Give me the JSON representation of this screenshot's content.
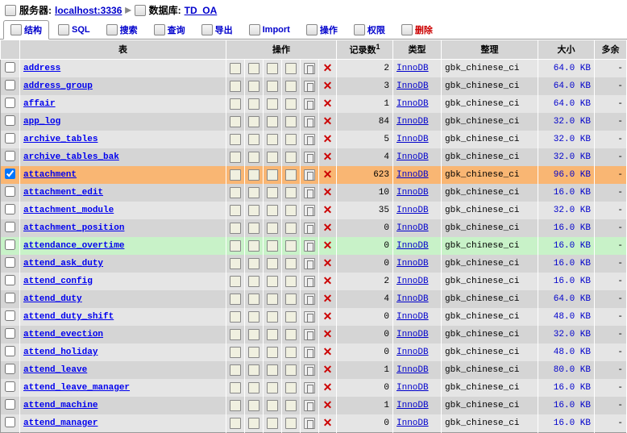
{
  "breadcrumb": {
    "server_label": "服务器:",
    "server_value": "localhost:3336",
    "db_label": "数据库:",
    "db_value": "TD_OA"
  },
  "tabs": [
    {
      "label": "结构",
      "active": true
    },
    {
      "label": "SQL",
      "active": false
    },
    {
      "label": "搜索",
      "active": false
    },
    {
      "label": "查询",
      "active": false
    },
    {
      "label": "导出",
      "active": false
    },
    {
      "label": "Import",
      "active": false
    },
    {
      "label": "操作",
      "active": false
    },
    {
      "label": "权限",
      "active": false
    },
    {
      "label": "删除",
      "active": false,
      "danger": true
    }
  ],
  "headers": {
    "table": "表",
    "ops": "操作",
    "records": "记录数",
    "type": "类型",
    "collation": "整理",
    "size": "大小",
    "overhead": "多余"
  },
  "rows": [
    {
      "name": "address",
      "rows": 2,
      "type": "InnoDB",
      "coll": "gbk_chinese_ci",
      "size": "64.0 KB",
      "over": "-",
      "state": "even"
    },
    {
      "name": "address_group",
      "rows": 3,
      "type": "InnoDB",
      "coll": "gbk_chinese_ci",
      "size": "64.0 KB",
      "over": "-",
      "state": "odd"
    },
    {
      "name": "affair",
      "rows": 1,
      "type": "InnoDB",
      "coll": "gbk_chinese_ci",
      "size": "64.0 KB",
      "over": "-",
      "state": "even"
    },
    {
      "name": "app_log",
      "rows": 84,
      "type": "InnoDB",
      "coll": "gbk_chinese_ci",
      "size": "32.0 KB",
      "over": "-",
      "state": "odd"
    },
    {
      "name": "archive_tables",
      "rows": 5,
      "type": "InnoDB",
      "coll": "gbk_chinese_ci",
      "size": "32.0 KB",
      "over": "-",
      "state": "even"
    },
    {
      "name": "archive_tables_bak",
      "rows": 4,
      "type": "InnoDB",
      "coll": "gbk_chinese_ci",
      "size": "32.0 KB",
      "over": "-",
      "state": "odd"
    },
    {
      "name": "attachment",
      "rows": 623,
      "type": "InnoDB",
      "coll": "gbk_chinese_ci",
      "size": "96.0 KB",
      "over": "-",
      "state": "sel",
      "checked": true
    },
    {
      "name": "attachment_edit",
      "rows": 10,
      "type": "InnoDB",
      "coll": "gbk_chinese_ci",
      "size": "16.0 KB",
      "over": "-",
      "state": "odd"
    },
    {
      "name": "attachment_module",
      "rows": 35,
      "type": "InnoDB",
      "coll": "gbk_chinese_ci",
      "size": "32.0 KB",
      "over": "-",
      "state": "even"
    },
    {
      "name": "attachment_position",
      "rows": 0,
      "type": "InnoDB",
      "coll": "gbk_chinese_ci",
      "size": "16.0 KB",
      "over": "-",
      "state": "odd"
    },
    {
      "name": "attendance_overtime",
      "rows": 0,
      "type": "InnoDB",
      "coll": "gbk_chinese_ci",
      "size": "16.0 KB",
      "over": "-",
      "state": "hl"
    },
    {
      "name": "attend_ask_duty",
      "rows": 0,
      "type": "InnoDB",
      "coll": "gbk_chinese_ci",
      "size": "16.0 KB",
      "over": "-",
      "state": "odd"
    },
    {
      "name": "attend_config",
      "rows": 2,
      "type": "InnoDB",
      "coll": "gbk_chinese_ci",
      "size": "16.0 KB",
      "over": "-",
      "state": "even"
    },
    {
      "name": "attend_duty",
      "rows": 4,
      "type": "InnoDB",
      "coll": "gbk_chinese_ci",
      "size": "64.0 KB",
      "over": "-",
      "state": "odd"
    },
    {
      "name": "attend_duty_shift",
      "rows": 0,
      "type": "InnoDB",
      "coll": "gbk_chinese_ci",
      "size": "48.0 KB",
      "over": "-",
      "state": "even"
    },
    {
      "name": "attend_evection",
      "rows": 0,
      "type": "InnoDB",
      "coll": "gbk_chinese_ci",
      "size": "32.0 KB",
      "over": "-",
      "state": "odd"
    },
    {
      "name": "attend_holiday",
      "rows": 0,
      "type": "InnoDB",
      "coll": "gbk_chinese_ci",
      "size": "48.0 KB",
      "over": "-",
      "state": "even"
    },
    {
      "name": "attend_leave",
      "rows": 1,
      "type": "InnoDB",
      "coll": "gbk_chinese_ci",
      "size": "80.0 KB",
      "over": "-",
      "state": "odd"
    },
    {
      "name": "attend_leave_manager",
      "rows": 0,
      "type": "InnoDB",
      "coll": "gbk_chinese_ci",
      "size": "16.0 KB",
      "over": "-",
      "state": "even"
    },
    {
      "name": "attend_machine",
      "rows": 1,
      "type": "InnoDB",
      "coll": "gbk_chinese_ci",
      "size": "16.0 KB",
      "over": "-",
      "state": "odd"
    },
    {
      "name": "attend_manager",
      "rows": 0,
      "type": "InnoDB",
      "coll": "gbk_chinese_ci",
      "size": "16.0 KB",
      "over": "-",
      "state": "even"
    }
  ]
}
